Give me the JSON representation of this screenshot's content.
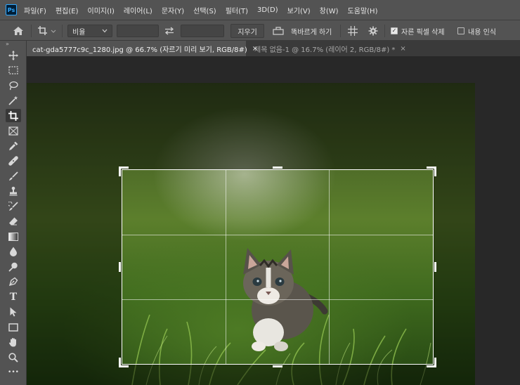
{
  "app": {
    "logo": "Ps"
  },
  "menu": [
    "파일(F)",
    "편집(E)",
    "이미지(I)",
    "레이어(L)",
    "문자(Y)",
    "선택(S)",
    "필터(T)",
    "3D(D)",
    "보기(V)",
    "창(W)",
    "도움말(H)"
  ],
  "options": {
    "ratio_select": "비율",
    "width_value": "",
    "height_value": "",
    "clear_label": "지우기",
    "straighten_label": "똑바르게 하기",
    "delete_cropped_label": "자른 픽셀 삭제",
    "delete_cropped_checked": true,
    "content_aware_label": "내용 인식",
    "content_aware_checked": false
  },
  "tabs": [
    {
      "label": "cat-gda5777c9c_1280.jpg @ 66.7% (자르기 미리 보기, RGB/8#)",
      "close": "×",
      "active": true
    },
    {
      "label": "제목 없음-1 @ 16.7% (레이어 2, RGB/8#) *",
      "close": "×",
      "active": false
    }
  ],
  "toolbar": {
    "collapse": "»",
    "tools": [
      {
        "name": "move-tool",
        "icon": "move-icon"
      },
      {
        "name": "marquee-tool",
        "icon": "marquee-icon"
      },
      {
        "name": "lasso-tool",
        "icon": "lasso-icon"
      },
      {
        "name": "magic-wand-tool",
        "icon": "magic-wand-icon"
      },
      {
        "name": "crop-tool",
        "icon": "crop-icon",
        "selected": true
      },
      {
        "name": "frame-tool",
        "icon": "frame-icon"
      },
      {
        "name": "eyedropper-tool",
        "icon": "eyedropper-icon"
      },
      {
        "name": "healing-brush-tool",
        "icon": "bandage-icon"
      },
      {
        "name": "brush-tool",
        "icon": "brush-icon"
      },
      {
        "name": "clone-stamp-tool",
        "icon": "stamp-icon"
      },
      {
        "name": "history-brush-tool",
        "icon": "history-brush-icon"
      },
      {
        "name": "eraser-tool",
        "icon": "eraser-icon"
      },
      {
        "name": "gradient-tool",
        "icon": "gradient-icon"
      },
      {
        "name": "blur-tool",
        "icon": "drop-icon"
      },
      {
        "name": "dodge-tool",
        "icon": "dodge-icon"
      },
      {
        "name": "pen-tool",
        "icon": "pen-icon"
      },
      {
        "name": "type-tool",
        "icon": "type-icon",
        "glyph": "T"
      },
      {
        "name": "path-selection-tool",
        "icon": "arrow-icon"
      },
      {
        "name": "rectangle-tool",
        "icon": "rectangle-icon"
      },
      {
        "name": "hand-tool",
        "icon": "hand-icon"
      },
      {
        "name": "zoom-tool",
        "icon": "zoom-icon"
      },
      {
        "name": "more-tools",
        "icon": "more-icon",
        "glyph": "•••"
      }
    ]
  },
  "colors": {
    "panel": "#535353",
    "canvas": "#282828",
    "tab_bar": "#3a3a3a",
    "accent": "#31a8ff"
  }
}
